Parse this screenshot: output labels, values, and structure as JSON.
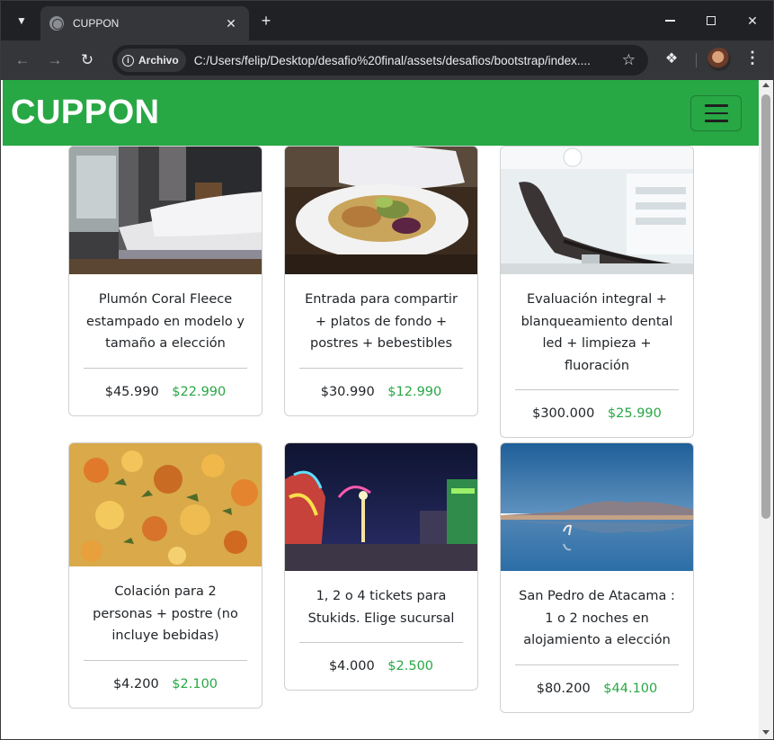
{
  "browser": {
    "tab_title": "CUPPON",
    "security_chip": "Archivo",
    "url": "C:/Users/felip/Desktop/desafio%20final/assets/desafios/bootstrap/index...."
  },
  "site": {
    "brand": "CUPPON"
  },
  "cards": [
    {
      "title": "Plumón Coral Fleece estampado en modelo y tamaño a elección",
      "old_price": "$45.990",
      "new_price": "$22.990",
      "image": "bedroom-photo"
    },
    {
      "title": "Entrada para compartir + platos de fondo + postres + bebestibles",
      "old_price": "$30.990",
      "new_price": "$12.990",
      "image": "salad-plate-photo"
    },
    {
      "title": "Evaluación integral + blanqueamiento dental led + limpieza + fluoración",
      "old_price": "$300.000",
      "new_price": "$25.990",
      "image": "dental-chair-photo"
    },
    {
      "title": "Colación para 2 personas + postre (no incluye bebidas)",
      "old_price": "$4.200",
      "new_price": "$2.100",
      "image": "vegetable-stew-photo"
    },
    {
      "title": "1, 2 o 4 tickets para Stukids. Elige sucursal",
      "old_price": "$4.000",
      "new_price": "$2.500",
      "image": "amusement-park-photo"
    },
    {
      "title": "San Pedro de Atacama : 1 o 2 noches en alojamiento a elección",
      "old_price": "$80.200",
      "new_price": "$44.100",
      "image": "salt-lagoon-photo"
    }
  ],
  "colors": {
    "navbar": "#28a745",
    "new_price": "#28a745"
  }
}
